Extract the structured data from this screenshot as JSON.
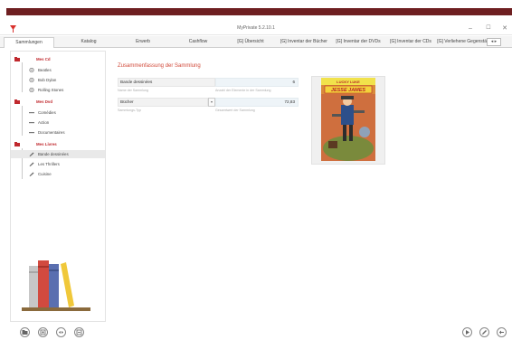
{
  "window": {
    "title": "MyPrivate 5.2.10.1",
    "minimize": "–",
    "maximize": "☐",
    "close": "✕"
  },
  "tabs": [
    {
      "label": "Sammlungen"
    },
    {
      "label": "Katalog"
    },
    {
      "label": "Erwerb"
    },
    {
      "label": "Cashflow"
    },
    {
      "label": "[G] Übersicht"
    },
    {
      "label": "[G] Inventar der Bücher"
    },
    {
      "label": "[G] Inventar der DVDs"
    },
    {
      "label": "[G] Inventar der CDs"
    },
    {
      "label": "[G] Verliehene Gegenstän"
    }
  ],
  "tab_scroll": "◂ ▸",
  "sidebar": {
    "tree": [
      {
        "label": "Mes Cd",
        "kind": "group",
        "icon": "folder-icon"
      },
      {
        "label": "Beatles",
        "kind": "item",
        "icon": "cd-icon"
      },
      {
        "label": "Bob Dylan",
        "kind": "item",
        "icon": "cd-icon"
      },
      {
        "label": "Rolling Stones",
        "kind": "item",
        "icon": "cd-icon"
      },
      {
        "label": "Mes Dvd",
        "kind": "group",
        "icon": "folder-icon"
      },
      {
        "label": "Comédies",
        "kind": "item",
        "icon": "dvd-icon"
      },
      {
        "label": "Action",
        "kind": "item",
        "icon": "dvd-icon"
      },
      {
        "label": "Documentaires",
        "kind": "item",
        "icon": "dvd-icon"
      },
      {
        "label": "Mes Livres",
        "kind": "group",
        "icon": "folder-icon"
      },
      {
        "label": "Bande dessinées",
        "kind": "item",
        "icon": "book-icon",
        "selected": true
      },
      {
        "label": "Les Thrillers",
        "kind": "item",
        "icon": "book-icon"
      },
      {
        "label": "Cuisine",
        "kind": "item",
        "icon": "book-icon"
      }
    ]
  },
  "summary": {
    "title": "Zusammenfassung der Sammlung",
    "collection_name": "Bande dessinées",
    "collection_name_caption": "Name der Sammlung",
    "item_count": "6",
    "item_count_caption": "Anzahl der Elemente in der Sammlung",
    "collection_type": "Bücher",
    "collection_type_caption": "Sammlungs-Typ",
    "total_value": "72,83",
    "total_value_caption": "Gesamtwert der Sammlung"
  },
  "cover": {
    "series": "LUCKY LUKE",
    "title": "JESSE JAMES"
  },
  "colors": {
    "accent": "#c0282d",
    "header_band": "#6e1f21",
    "title_red": "#d14a3a"
  }
}
